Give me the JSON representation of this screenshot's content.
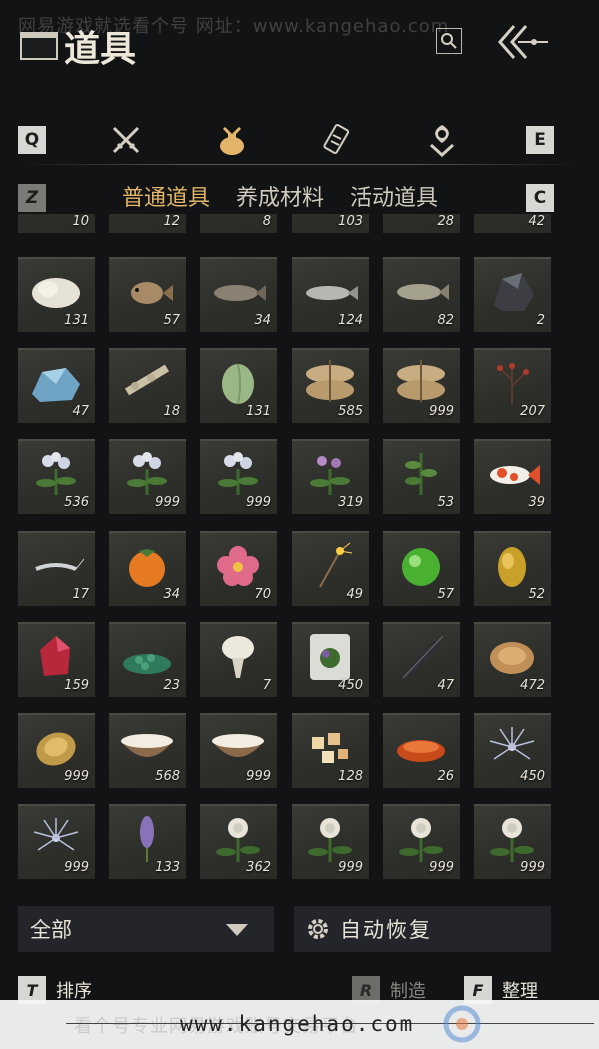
{
  "watermark_top": "网易游戏就选看个号   网址：www.kangehao.com",
  "title": "道具",
  "keys": {
    "left": "Q",
    "right": "E",
    "left2": "Z",
    "right2": "C"
  },
  "categories": [
    {
      "icon": "crossed-swords-icon"
    },
    {
      "icon": "item-bag-icon",
      "active": true
    },
    {
      "icon": "scroll-icon"
    },
    {
      "icon": "lotus-badge-icon"
    }
  ],
  "subtabs": [
    "普通道具",
    "养成材料",
    "活动道具"
  ],
  "accent_color": "#e2b56a",
  "items": [
    {
      "icon": "misc-item-icon",
      "count": "10"
    },
    {
      "icon": "misc-item-icon",
      "count": "12"
    },
    {
      "icon": "misc-item-icon",
      "count": "8"
    },
    {
      "icon": "misc-item-icon",
      "count": "103"
    },
    {
      "icon": "misc-item-icon",
      "count": "28"
    },
    {
      "icon": "misc-item-icon",
      "count": "42"
    },
    {
      "icon": "white-fur-icon",
      "count": "131"
    },
    {
      "icon": "pufferfish-icon",
      "count": "57"
    },
    {
      "icon": "rockfish-icon",
      "count": "34"
    },
    {
      "icon": "silver-fish-icon",
      "count": "124"
    },
    {
      "icon": "trout-icon",
      "count": "82"
    },
    {
      "icon": "dark-ore-icon",
      "count": "2"
    },
    {
      "icon": "blue-crystal-icon",
      "count": "47"
    },
    {
      "icon": "bone-icon",
      "count": "18"
    },
    {
      "icon": "melon-icon",
      "count": "131"
    },
    {
      "icon": "grain-sack-icon",
      "count": "585"
    },
    {
      "icon": "grain-sack-icon",
      "count": "999"
    },
    {
      "icon": "red-berry-branch-icon",
      "count": "207"
    },
    {
      "icon": "white-flower-herb-icon",
      "count": "536"
    },
    {
      "icon": "white-flower-herb-icon",
      "count": "999"
    },
    {
      "icon": "white-flower-herb-icon",
      "count": "999"
    },
    {
      "icon": "purple-flower-herb-icon",
      "count": "319"
    },
    {
      "icon": "green-herb-icon",
      "count": "53"
    },
    {
      "icon": "koi-fish-icon",
      "count": "39"
    },
    {
      "icon": "shrimp-icon",
      "count": "17"
    },
    {
      "icon": "persimmon-icon",
      "count": "34"
    },
    {
      "icon": "pink-flower-icon",
      "count": "70"
    },
    {
      "icon": "sparkler-icon",
      "count": "49"
    },
    {
      "icon": "jade-orb-icon",
      "count": "57"
    },
    {
      "icon": "gold-nugget-icon",
      "count": "52"
    },
    {
      "icon": "red-crystal-icon",
      "count": "159"
    },
    {
      "icon": "green-gems-icon",
      "count": "23"
    },
    {
      "icon": "white-flower-bouquet-icon",
      "count": "7"
    },
    {
      "icon": "herb-card-icon",
      "count": "450"
    },
    {
      "icon": "black-feather-icon",
      "count": "47"
    },
    {
      "icon": "bronze-ingot-icon",
      "count": "472"
    },
    {
      "icon": "gold-ingot-icon",
      "count": "999"
    },
    {
      "icon": "milk-bowl-icon",
      "count": "568"
    },
    {
      "icon": "milk-bowl-icon",
      "count": "999"
    },
    {
      "icon": "tofu-cubes-icon",
      "count": "128"
    },
    {
      "icon": "red-cake-icon",
      "count": "26"
    },
    {
      "icon": "blue-dandelion-icon",
      "count": "450"
    },
    {
      "icon": "blue-dandelion-icon",
      "count": "999"
    },
    {
      "icon": "lavender-icon",
      "count": "133"
    },
    {
      "icon": "white-camellia-icon",
      "count": "362"
    },
    {
      "icon": "white-camellia-icon",
      "count": "999"
    },
    {
      "icon": "white-camellia-icon",
      "count": "999"
    },
    {
      "icon": "white-camellia-icon",
      "count": "999"
    }
  ],
  "filter": {
    "label": "全部"
  },
  "auto_restore": {
    "label": "自动恢复"
  },
  "hints": {
    "sort": {
      "key": "T",
      "label": "排序"
    },
    "craft": {
      "key": "R",
      "label": "制造"
    },
    "organize": {
      "key": "F",
      "label": "整理"
    }
  },
  "footer": {
    "watermark": "看个号专业网易游戏账号交易平台",
    "url": "www.kangehao.com"
  }
}
